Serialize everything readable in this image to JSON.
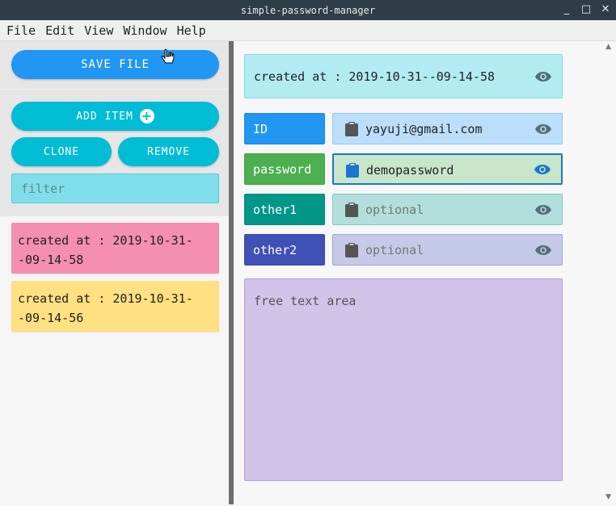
{
  "window": {
    "title": "simple-password-manager",
    "controls": [
      "_",
      "□",
      "✕"
    ]
  },
  "menu": [
    "File",
    "Edit",
    "View",
    "Window",
    "Help"
  ],
  "sidebar": {
    "save_label": "SAVE FILE",
    "add_label": "ADD ITEM",
    "clone_label": "CLONE",
    "remove_label": "REMOVE",
    "filter_placeholder": "filter",
    "entries": [
      {
        "text": "created at : 2019-10-31--09-14-58",
        "color": "#f48fb1"
      },
      {
        "text": "created at : 2019-10-31--09-14-56",
        "color": "#ffe082"
      }
    ]
  },
  "detail": {
    "created": "created at : 2019-10-31--09-14-58",
    "rows": [
      {
        "label": "ID",
        "value": "yayuji@gmail.com",
        "placeholder": "",
        "label_color": "#2196f3",
        "field_color": "#bbdefb"
      },
      {
        "label": "password",
        "value": "demopassword",
        "placeholder": "",
        "label_color": "#4caf50",
        "field_color": "#c8e6c9"
      },
      {
        "label": "other1",
        "value": "",
        "placeholder": "optional",
        "label_color": "#009688",
        "field_color": "#b2dfdb"
      },
      {
        "label": "other2",
        "value": "",
        "placeholder": "optional",
        "label_color": "#3f51b5",
        "field_color": "#c5cae9"
      }
    ],
    "free_text_placeholder": "free text area"
  },
  "colors": {
    "accent_blue": "#2196f3",
    "accent_cyan": "#00bcd4",
    "eye_icon": "#546e7a"
  }
}
